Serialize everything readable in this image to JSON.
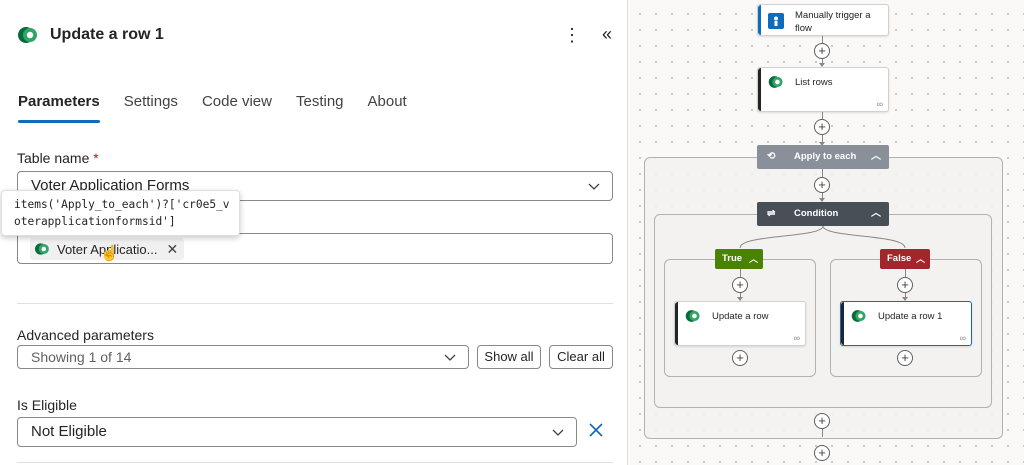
{
  "panel": {
    "title": "Update a row 1",
    "tabs": [
      {
        "label": "Parameters",
        "active": true
      },
      {
        "label": "Settings"
      },
      {
        "label": "Code view"
      },
      {
        "label": "Testing"
      },
      {
        "label": "About"
      }
    ],
    "table_name": {
      "label": "Table name",
      "required_mark": "*",
      "value": "Voter Application Forms"
    },
    "row_id": {
      "tooltip_line1": "items('Apply_to_each')?['cr0e5_v",
      "tooltip_line2": "oterapplicationformsid']",
      "token_label": "Voter Applicatio...",
      "token_remove": "✕"
    },
    "advanced": {
      "label": "Advanced parameters",
      "value": "Showing 1 of 14",
      "show_all": "Show all",
      "clear_all": "Clear all"
    },
    "is_eligible": {
      "label": "Is Eligible",
      "value": "Not Eligible"
    }
  },
  "flow": {
    "trigger": "Manually trigger a flow",
    "list_rows": "List rows",
    "apply_to_each": "Apply to each",
    "condition": "Condition",
    "true_label": "True",
    "false_label": "False",
    "update_row": "Update a row",
    "update_row_1": "Update a row 1"
  },
  "colors": {
    "accent": "#0f6cbd",
    "true_branch": "#498205",
    "false_branch": "#a4262c",
    "loop_header": "#8a9099",
    "condition_header": "#484f57"
  },
  "icons": [
    "dataverse-logo",
    "more-vertical-icon",
    "collapse-icon",
    "chevron-down-icon",
    "dismiss-icon",
    "hand-cursor-icon",
    "add-icon",
    "link-icon",
    "loop-icon",
    "condition-icon",
    "trigger-icon"
  ]
}
